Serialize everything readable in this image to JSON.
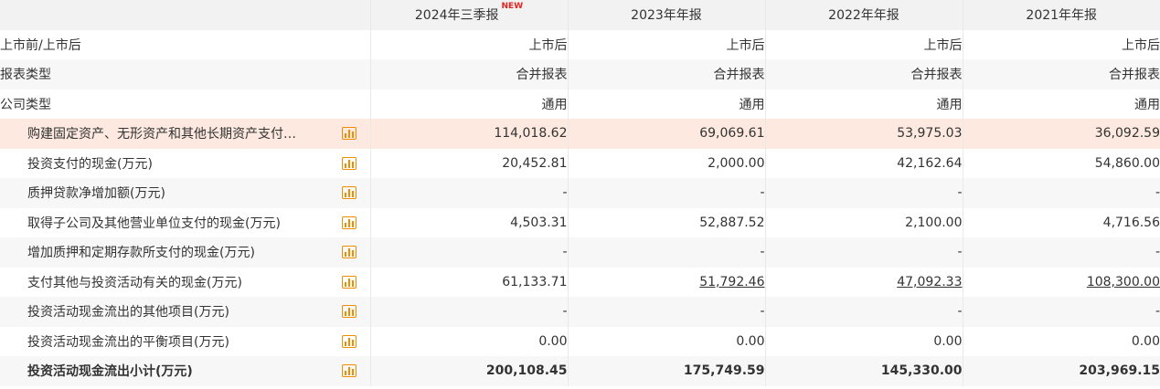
{
  "header": {
    "columns": [
      "2024年三季报",
      "2023年年报",
      "2022年年报",
      "2021年年报"
    ],
    "new_badge": "NEW"
  },
  "info_rows": [
    {
      "label": "上市前/上市后",
      "values": [
        "上市后",
        "上市后",
        "上市后",
        "上市后"
      ]
    },
    {
      "label": "报表类型",
      "values": [
        "合并报表",
        "合并报表",
        "合并报表",
        "合并报表"
      ]
    },
    {
      "label": "公司类型",
      "values": [
        "通用",
        "通用",
        "通用",
        "通用"
      ]
    }
  ],
  "data_rows": [
    {
      "label": "购建固定资产、无形资产和其他长期资产支付…",
      "values": [
        "114,018.62",
        "69,069.61",
        "53,975.03",
        "36,092.59"
      ]
    },
    {
      "label": "投资支付的现金(万元)",
      "values": [
        "20,452.81",
        "2,000.00",
        "42,162.64",
        "54,860.00"
      ]
    },
    {
      "label": "质押贷款净增加额(万元)",
      "values": [
        "-",
        "-",
        "-",
        "-"
      ]
    },
    {
      "label": "取得子公司及其他营业单位支付的现金(万元)",
      "values": [
        "4,503.31",
        "52,887.52",
        "2,100.00",
        "4,716.56"
      ]
    },
    {
      "label": "增加质押和定期存款所支付的现金(万元)",
      "values": [
        "-",
        "-",
        "-",
        "-"
      ]
    },
    {
      "label": "支付其他与投资活动有关的现金(万元)",
      "values": [
        "61,133.71",
        "51,792.46",
        "47,092.33",
        "108,300.00"
      ]
    },
    {
      "label": "投资活动现金流出的其他项目(万元)",
      "values": [
        "-",
        "-",
        "-",
        "-"
      ]
    },
    {
      "label": "投资活动现金流出的平衡项目(万元)",
      "values": [
        "0.00",
        "0.00",
        "0.00",
        "0.00"
      ]
    },
    {
      "label": "投资活动现金流出小计(万元)",
      "values": [
        "200,108.45",
        "175,749.59",
        "145,330.00",
        "203,969.15"
      ]
    }
  ],
  "colors": {
    "highlight_row": "#fde9df",
    "chart_icon": "#f08c00",
    "new_badge": "#e3231e",
    "header_bg": "#f2f2f2"
  },
  "icons": {
    "row_chart": "bar-chart-icon"
  }
}
